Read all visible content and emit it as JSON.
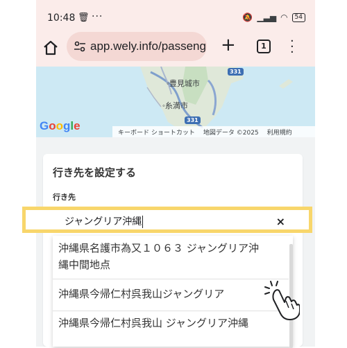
{
  "status_bar": {
    "time": "10:48",
    "battery": "54"
  },
  "browser": {
    "url": "app.wely.info/passeng",
    "tab_count": "1"
  },
  "map": {
    "labels": [
      "豊見城市",
      "糸満市"
    ],
    "route_badges": [
      "331",
      "331"
    ],
    "footer": [
      "キーボード ショートカット",
      "地図データ ©2025",
      "利用規約"
    ]
  },
  "form": {
    "title": "行き先を設定する",
    "destination_label": "行き先",
    "input_value": "ジャングリア沖縄",
    "clear_symbol": "×"
  },
  "suggestions": [
    {
      "line1": "沖縄県名護市為又１０６３ ジャングリア沖",
      "line2": "縄中間地点"
    },
    {
      "line1": "沖縄県今帰仁村呉我山ジャングリア"
    },
    {
      "line1": "沖縄県今帰仁村呉我山 ジャングリア沖縄"
    }
  ],
  "colors": {
    "highlight": "#f8d66b",
    "browser_bar": "#fbecea",
    "map_water": "#cde9f4"
  }
}
